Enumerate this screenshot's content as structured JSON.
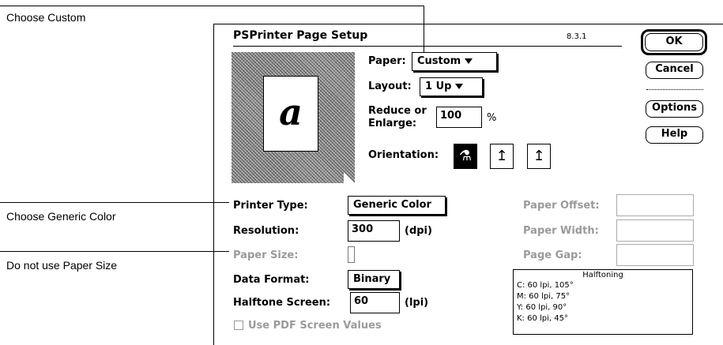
{
  "annotations": {
    "custom": "Choose Custom",
    "generic": "Choose Generic Color",
    "papersize": "Do not use Paper Size"
  },
  "dialog": {
    "title": "PSPrinter Page Setup",
    "version": "8.3.1",
    "preview_letter": "a"
  },
  "buttons": {
    "ok": "OK",
    "cancel": "Cancel",
    "options": "Options",
    "help": "Help"
  },
  "paper": {
    "label": "Paper:",
    "value": "Custom"
  },
  "layout": {
    "label": "Layout:",
    "value": "1 Up"
  },
  "reduce": {
    "label_line1": "Reduce or",
    "label_line2": "Enlarge:",
    "value": "100",
    "unit": "%"
  },
  "orientation": {
    "label": "Orientation:",
    "selected": "portrait"
  },
  "printer_type": {
    "label": "Printer Type:",
    "value": "Generic Color"
  },
  "resolution": {
    "label": "Resolution:",
    "value": "300",
    "unit": "(dpi)"
  },
  "paper_size": {
    "label": "Paper Size:"
  },
  "data_format": {
    "label": "Data Format:",
    "value": "Binary"
  },
  "halftone_screen": {
    "label": "Halftone Screen:",
    "value": "60",
    "unit": "(lpi)"
  },
  "pdf_screen": {
    "label": "Use PDF Screen Values",
    "checked": false
  },
  "paper_offset": {
    "label": "Paper Offset:"
  },
  "paper_width": {
    "label": "Paper Width:"
  },
  "page_gap": {
    "label": "Page Gap:"
  },
  "halftoning": {
    "title": "Halftoning",
    "lines": [
      "C: 60 lpi, 105°",
      "M: 60 lpi, 75°",
      "Y: 60 lpi, 90°",
      "K: 60 lpi, 45°"
    ]
  }
}
